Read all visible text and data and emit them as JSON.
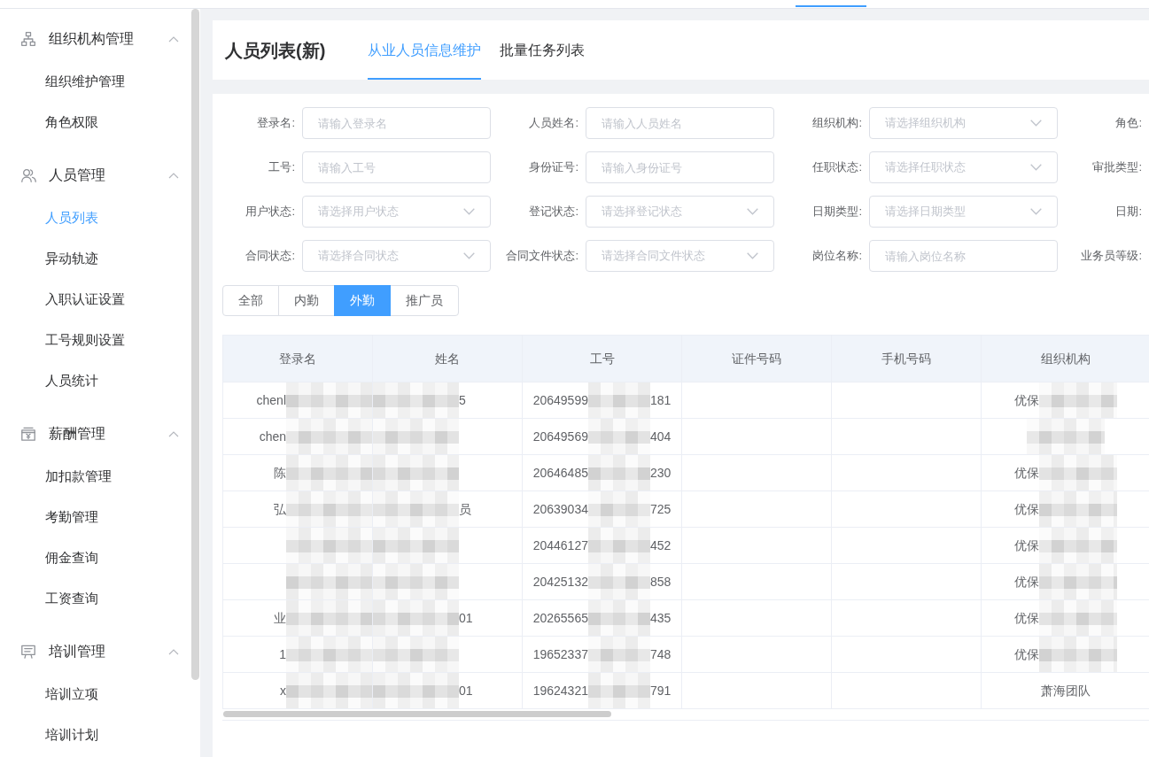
{
  "sidebar": {
    "groups": [
      {
        "title": "组织机构管理",
        "expanded": true,
        "items": [
          {
            "label": "组织维护管理",
            "selected": false
          },
          {
            "label": "角色权限",
            "selected": false
          }
        ]
      },
      {
        "title": "人员管理",
        "expanded": true,
        "items": [
          {
            "label": "人员列表",
            "selected": true
          },
          {
            "label": "异动轨迹",
            "selected": false
          },
          {
            "label": "入职认证设置",
            "selected": false
          },
          {
            "label": "工号规则设置",
            "selected": false
          },
          {
            "label": "人员统计",
            "selected": false
          }
        ]
      },
      {
        "title": "薪酬管理",
        "expanded": true,
        "items": [
          {
            "label": "加扣款管理",
            "selected": false
          },
          {
            "label": "考勤管理",
            "selected": false
          },
          {
            "label": "佣金查询",
            "selected": false
          },
          {
            "label": "工资查询",
            "selected": false
          }
        ]
      },
      {
        "title": "培训管理",
        "expanded": true,
        "items": [
          {
            "label": "培训立项",
            "selected": false
          },
          {
            "label": "培训计划",
            "selected": false
          }
        ]
      }
    ]
  },
  "header": {
    "title": "人员列表(新)",
    "tabs": [
      {
        "label": "从业人员信息维护",
        "selected": true
      },
      {
        "label": "批量任务列表",
        "selected": false
      }
    ]
  },
  "filters": [
    {
      "label": "登录名:",
      "kind": "input",
      "placeholder": "请输入登录名"
    },
    {
      "label": "人员姓名:",
      "kind": "input",
      "placeholder": "请输入人员姓名"
    },
    {
      "label": "组织机构:",
      "kind": "select",
      "placeholder": "请选择组织机构"
    },
    {
      "label": "角色:"
    },
    {
      "label": "工号:",
      "kind": "input",
      "placeholder": "请输入工号"
    },
    {
      "label": "身份证号:",
      "kind": "input",
      "placeholder": "请输入身份证号"
    },
    {
      "label": "任职状态:",
      "kind": "select",
      "placeholder": "请选择任职状态"
    },
    {
      "label": "审批类型:"
    },
    {
      "label": "用户状态:",
      "kind": "select",
      "placeholder": "请选择用户状态"
    },
    {
      "label": "登记状态:",
      "kind": "select",
      "placeholder": "请选择登记状态"
    },
    {
      "label": "日期类型:",
      "kind": "select",
      "placeholder": "请选择日期类型"
    },
    {
      "label": "日期:"
    },
    {
      "label": "合同状态:",
      "kind": "select",
      "placeholder": "请选择合同状态"
    },
    {
      "label": "合同文件状态:",
      "kind": "select",
      "placeholder": "请选择合同文件状态"
    },
    {
      "label": "岗位名称:",
      "kind": "input",
      "placeholder": "请输入岗位名称"
    },
    {
      "label": "业务员等级:"
    }
  ],
  "staff_types": [
    {
      "label": "全部",
      "selected": false
    },
    {
      "label": "内勤",
      "selected": false
    },
    {
      "label": "外勤",
      "selected": true
    },
    {
      "label": "推广员",
      "selected": false
    }
  ],
  "table": {
    "columns": [
      "登录名",
      "姓名",
      "工号",
      "证件号码",
      "手机号码",
      "组织机构"
    ],
    "rows": [
      {
        "login_name": [
          {
            "kind": "text",
            "text": "chenl"
          },
          {
            "kind": "redacted"
          }
        ],
        "name": [
          {
            "kind": "redacted"
          },
          {
            "kind": "text",
            "text": "5"
          }
        ],
        "employee_no": [
          {
            "kind": "text",
            "text": "20649599"
          },
          {
            "kind": "redacted"
          },
          {
            "kind": "text",
            "text": "181"
          }
        ],
        "organization": [
          {
            "kind": "text",
            "text": "优保"
          },
          {
            "kind": "redacted"
          }
        ]
      },
      {
        "login_name": [
          {
            "kind": "text",
            "text": "chen"
          },
          {
            "kind": "redacted"
          }
        ],
        "name": [
          {
            "kind": "redacted"
          }
        ],
        "employee_no": [
          {
            "kind": "text",
            "text": "20649569"
          },
          {
            "kind": "redacted"
          },
          {
            "kind": "text",
            "text": "404"
          }
        ],
        "organization": [
          {
            "kind": "redacted"
          }
        ]
      },
      {
        "login_name": [
          {
            "kind": "text",
            "text": "陈"
          },
          {
            "kind": "redacted"
          }
        ],
        "name": [
          {
            "kind": "redacted"
          }
        ],
        "employee_no": [
          {
            "kind": "text",
            "text": "20646485"
          },
          {
            "kind": "redacted"
          },
          {
            "kind": "text",
            "text": "230"
          }
        ],
        "organization": [
          {
            "kind": "text",
            "text": "优保"
          },
          {
            "kind": "redacted"
          }
        ]
      },
      {
        "login_name": [
          {
            "kind": "text",
            "text": "弘"
          },
          {
            "kind": "redacted"
          }
        ],
        "name": [
          {
            "kind": "redacted"
          },
          {
            "kind": "text",
            "text": "员"
          }
        ],
        "employee_no": [
          {
            "kind": "text",
            "text": "20639034"
          },
          {
            "kind": "redacted"
          },
          {
            "kind": "text",
            "text": "725"
          }
        ],
        "organization": [
          {
            "kind": "text",
            "text": "优保"
          },
          {
            "kind": "redacted"
          }
        ]
      },
      {
        "login_name": [
          {
            "kind": "redacted"
          }
        ],
        "name": [
          {
            "kind": "redacted"
          }
        ],
        "employee_no": [
          {
            "kind": "text",
            "text": "20446127"
          },
          {
            "kind": "redacted"
          },
          {
            "kind": "text",
            "text": "452"
          }
        ],
        "organization": [
          {
            "kind": "text",
            "text": "优保"
          },
          {
            "kind": "redacted"
          }
        ]
      },
      {
        "login_name": [
          {
            "kind": "redacted"
          }
        ],
        "name": [
          {
            "kind": "redacted"
          }
        ],
        "employee_no": [
          {
            "kind": "text",
            "text": "20425132"
          },
          {
            "kind": "redacted"
          },
          {
            "kind": "text",
            "text": "858"
          }
        ],
        "organization": [
          {
            "kind": "text",
            "text": "优保"
          },
          {
            "kind": "redacted"
          }
        ]
      },
      {
        "login_name": [
          {
            "kind": "text",
            "text": "业"
          },
          {
            "kind": "redacted"
          }
        ],
        "name": [
          {
            "kind": "redacted"
          },
          {
            "kind": "text",
            "text": "01"
          }
        ],
        "employee_no": [
          {
            "kind": "text",
            "text": "20265565"
          },
          {
            "kind": "redacted"
          },
          {
            "kind": "text",
            "text": "435"
          }
        ],
        "organization": [
          {
            "kind": "text",
            "text": "优保"
          },
          {
            "kind": "redacted"
          }
        ]
      },
      {
        "login_name": [
          {
            "kind": "text",
            "text": "1"
          },
          {
            "kind": "redacted"
          }
        ],
        "name": [
          {
            "kind": "redacted"
          }
        ],
        "employee_no": [
          {
            "kind": "text",
            "text": "19652337"
          },
          {
            "kind": "redacted"
          },
          {
            "kind": "text",
            "text": "748"
          }
        ],
        "organization": [
          {
            "kind": "text",
            "text": "优保"
          },
          {
            "kind": "redacted"
          }
        ]
      },
      {
        "login_name": [
          {
            "kind": "text",
            "text": "x"
          },
          {
            "kind": "redacted"
          }
        ],
        "name": [
          {
            "kind": "redacted"
          },
          {
            "kind": "text",
            "text": "01"
          }
        ],
        "employee_no": [
          {
            "kind": "text",
            "text": "19624321"
          },
          {
            "kind": "redacted"
          },
          {
            "kind": "text",
            "text": "791"
          }
        ],
        "organization": [
          {
            "kind": "text",
            "text": "萧海团队"
          }
        ]
      }
    ]
  }
}
